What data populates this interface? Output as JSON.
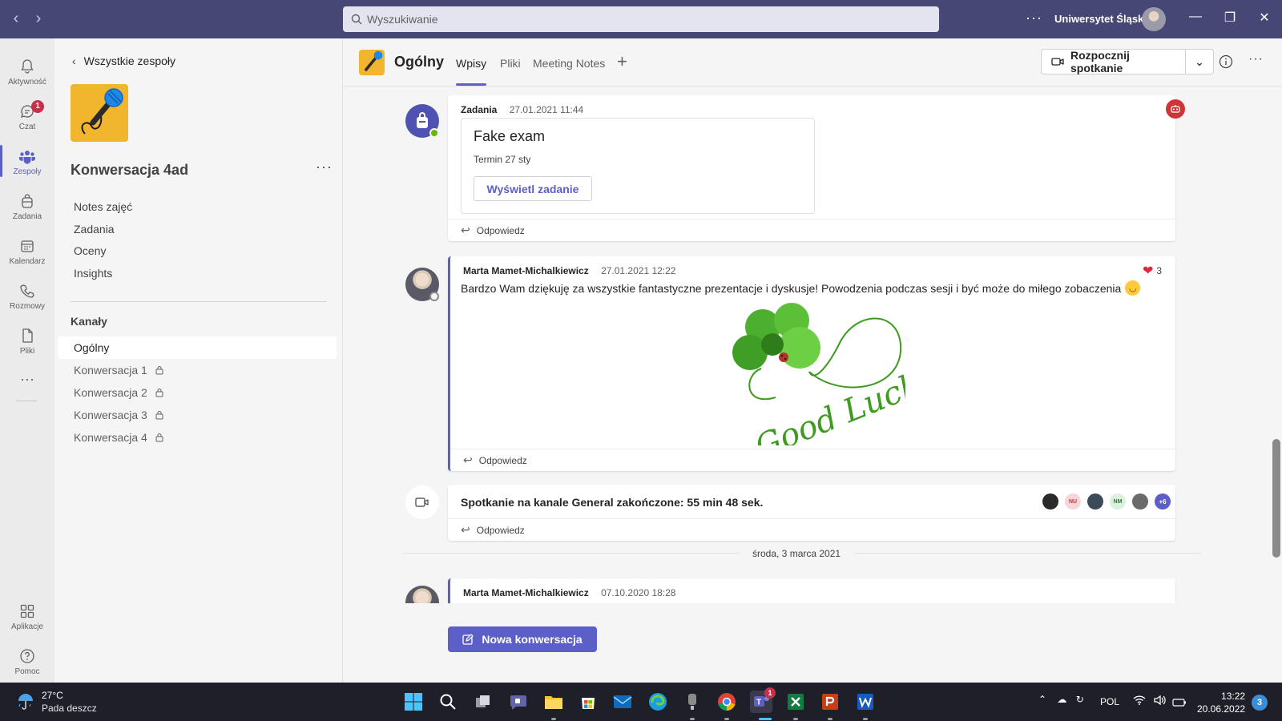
{
  "titlebar": {
    "search_placeholder": "Wyszukiwanie",
    "org_name": "Uniwersytet Śląski",
    "more_dots": "···"
  },
  "appbar": {
    "items": [
      {
        "label": "Aktywność",
        "icon": "bell-icon"
      },
      {
        "label": "Czat",
        "icon": "chat-icon",
        "badge": "1"
      },
      {
        "label": "Zespoły",
        "icon": "teams-icon",
        "active": true
      },
      {
        "label": "Zadania",
        "icon": "backpack-icon"
      },
      {
        "label": "Kalendarz",
        "icon": "calendar-icon"
      },
      {
        "label": "Rozmowy",
        "icon": "phone-icon"
      },
      {
        "label": "Pliki",
        "icon": "file-icon"
      }
    ],
    "more": "···",
    "apps_label": "Aplikacje",
    "help_label": "Pomoc"
  },
  "teampane": {
    "back_label": "Wszystkie zespoły",
    "team_name": "Konwersacja 4ad",
    "more": "···",
    "links": [
      "Notes zajęć",
      "Zadania",
      "Oceny",
      "Insights"
    ],
    "channels_label": "Kanały",
    "channels": [
      {
        "name": "Ogólny",
        "selected": true,
        "private": false
      },
      {
        "name": "Konwersacja 1",
        "private": true
      },
      {
        "name": "Konwersacja 2",
        "private": true
      },
      {
        "name": "Konwersacja 3",
        "private": true
      },
      {
        "name": "Konwersacja 4",
        "private": true
      }
    ]
  },
  "header": {
    "channel_name": "Ogólny",
    "tabs": [
      "Wpisy",
      "Pliki",
      "Meeting Notes"
    ],
    "active_tab": "Wpisy",
    "meet_button": "Rozpocznij spotkanie"
  },
  "feed": {
    "posts": [
      {
        "author": "Zadania",
        "time": "27.01.2021 11:44",
        "card_title": "Fake exam",
        "card_due": "Termin 27 sty",
        "card_button": "Wyświetl zadanie",
        "reply": "Odpowiedz"
      },
      {
        "author": "Marta Mamet-Michalkiewicz",
        "time": "27.01.2021 12:22",
        "text": "Bardzo Wam dziękuję za wszystkie fantastyczne prezentacje i dyskusje! Powodzenia podczas sesji i być może do miłego zobaczenia",
        "reaction_count": "3",
        "image_text": "Good Luck",
        "reply": "Odpowiedz"
      },
      {
        "meeting_text": "Spotkanie na kanale General zakończone: 55 min 48 sek.",
        "participants": [
          "NU",
          "NM"
        ],
        "more_participants": "+6",
        "reply": "Odpowiedz"
      }
    ],
    "date_divider": "środa, 3 marca 2021",
    "last_post": {
      "author": "Marta Mamet-Michalkiewicz",
      "time": "07.10.2020 18:28"
    }
  },
  "new_conversation": "Nowa konwersacja",
  "taskbar": {
    "temp": "27°C",
    "condition": "Pada deszcz",
    "lang": "POL",
    "time": "13:22",
    "date": "20.06.2022",
    "notifications": "3",
    "teams_badge": "1"
  },
  "colors": {
    "titlebar": "#464775",
    "accent": "#5b5fc7",
    "badge": "#c4314b",
    "team_avatar": "#f2b52e"
  }
}
